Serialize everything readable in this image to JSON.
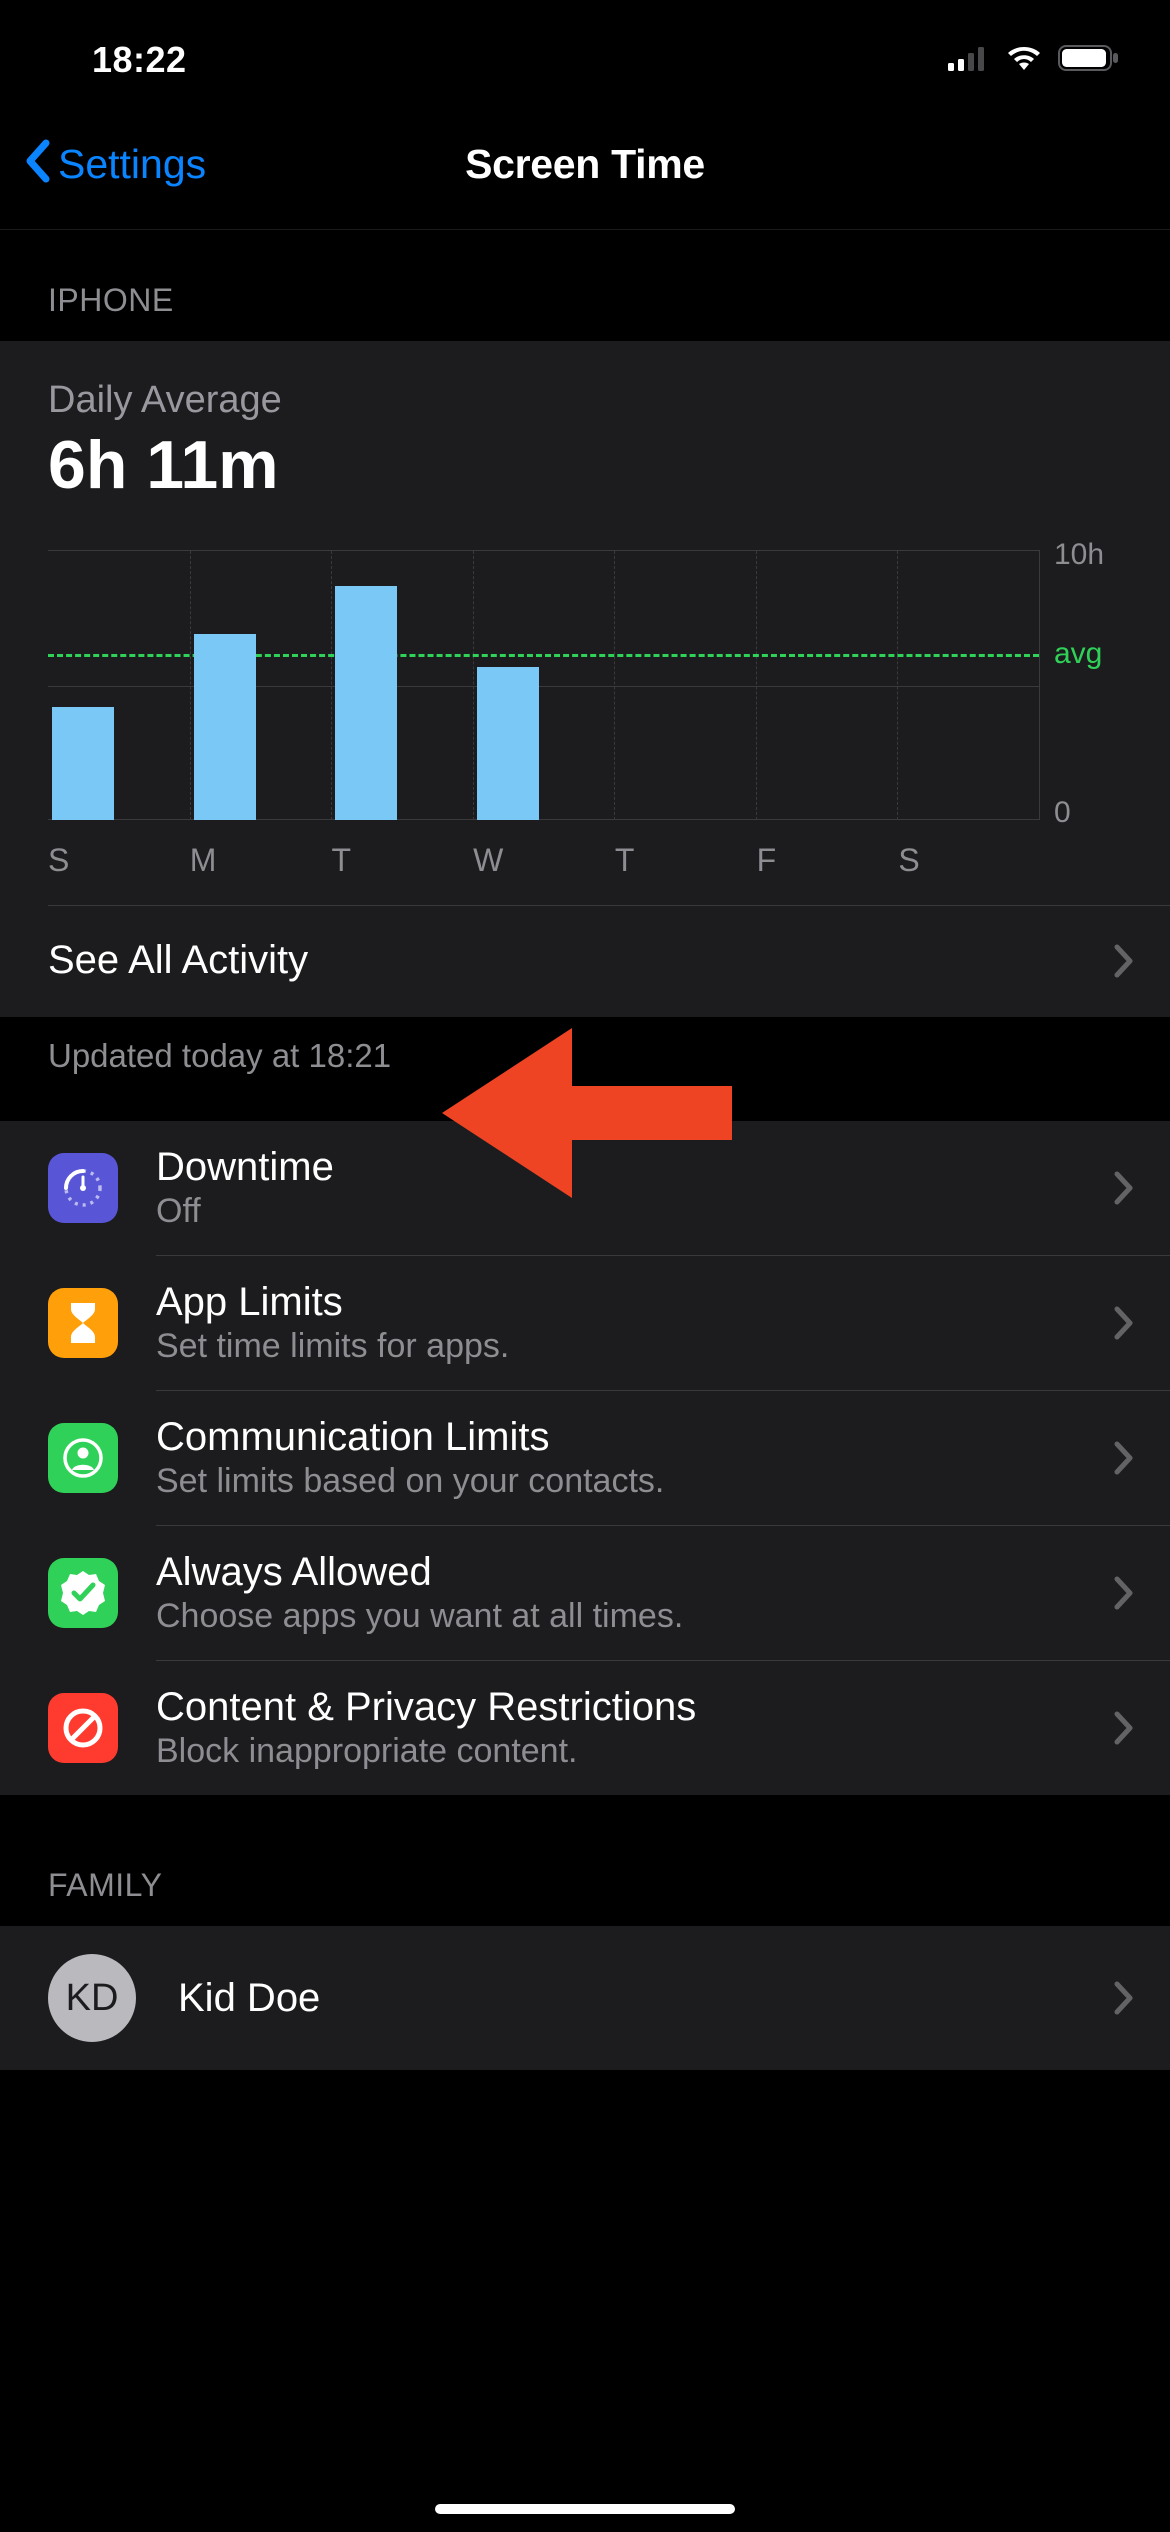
{
  "status_bar": {
    "time": "18:22"
  },
  "nav": {
    "back_label": "Settings",
    "title": "Screen Time"
  },
  "sections": {
    "iphone_header": "IPHONE",
    "family_header": "FAMILY"
  },
  "overview": {
    "daily_label": "Daily Average",
    "daily_value": "6h 11m",
    "see_all_label": "See All Activity",
    "updated_text": "Updated today at 18:21"
  },
  "chart_data": {
    "type": "bar",
    "categories": [
      "S",
      "M",
      "T",
      "W",
      "T",
      "F",
      "S"
    ],
    "values": [
      4.2,
      6.9,
      8.7,
      5.7,
      0,
      0,
      0
    ],
    "avg_line_value": 6.18,
    "avg_label": "avg",
    "ylabel_top": "10h",
    "ylabel_bot": "0",
    "ylim": [
      0,
      10
    ]
  },
  "settings": [
    {
      "title": "Downtime",
      "sub": "Off",
      "icon": "downtime",
      "icon_bg": "#5856d6"
    },
    {
      "title": "App Limits",
      "sub": "Set time limits for apps.",
      "icon": "hourglass",
      "icon_bg": "#ff9f0a"
    },
    {
      "title": "Communication Limits",
      "sub": "Set limits based on your contacts.",
      "icon": "contact",
      "icon_bg": "#30d158"
    },
    {
      "title": "Always Allowed",
      "sub": "Choose apps you want at all times.",
      "icon": "checkbadge",
      "icon_bg": "#30d158"
    },
    {
      "title": "Content & Privacy Restrictions",
      "sub": "Block inappropriate content.",
      "icon": "nosign",
      "icon_bg": "#ff3b30"
    }
  ],
  "family": [
    {
      "initials": "KD",
      "name": "Kid Doe"
    }
  ]
}
